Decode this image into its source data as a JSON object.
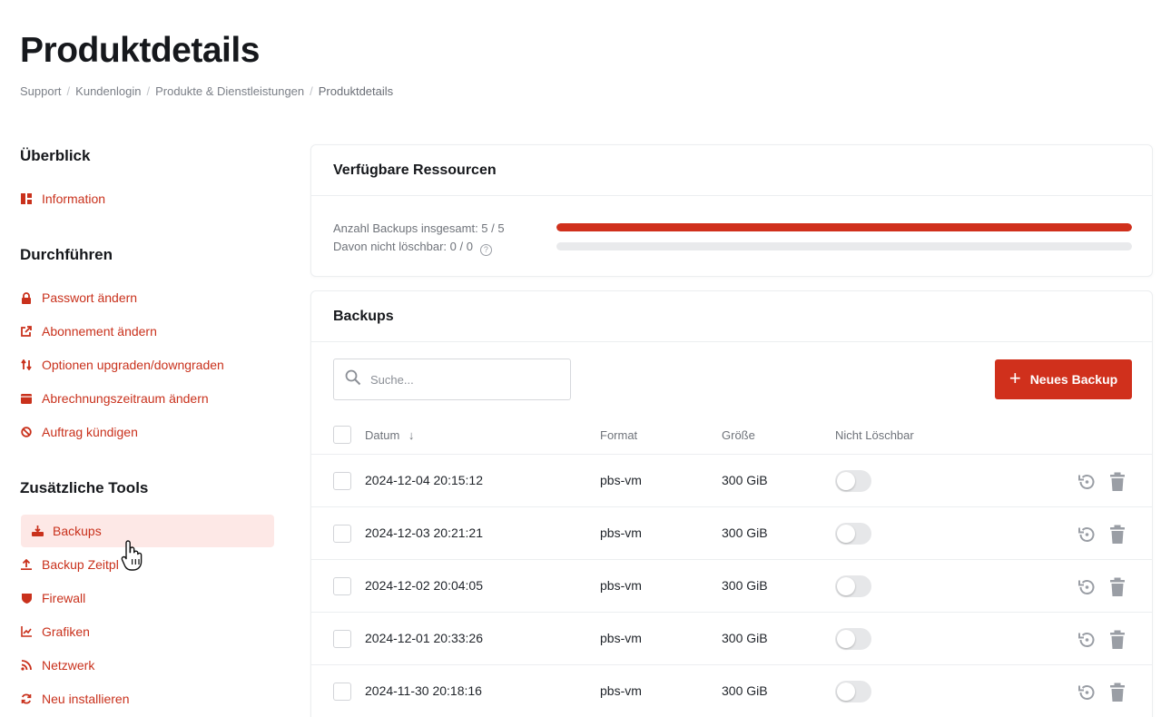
{
  "page": {
    "title": "Produktdetails",
    "breadcrumb": [
      "Support",
      "Kundenlogin",
      "Produkte & Dienstleistungen",
      "Produktdetails"
    ]
  },
  "sidebar": {
    "sections": [
      {
        "heading": "Überblick",
        "items": [
          {
            "label": "Information",
            "icon": "dashboard-icon"
          }
        ]
      },
      {
        "heading": "Durchführen",
        "items": [
          {
            "label": "Passwort ändern",
            "icon": "lock-icon"
          },
          {
            "label": "Abonnement ändern",
            "icon": "external-link-icon"
          },
          {
            "label": "Optionen upgraden/downgraden",
            "icon": "arrows-updown-icon"
          },
          {
            "label": "Abrechnungszeitraum ändern",
            "icon": "wallet-icon"
          },
          {
            "label": "Auftrag kündigen",
            "icon": "ban-icon"
          }
        ]
      },
      {
        "heading": "Zusätzliche Tools",
        "items": [
          {
            "label": "Backups",
            "icon": "download-tray-icon",
            "active": true
          },
          {
            "label": "Backup Zeitpl",
            "icon": "upload-icon"
          },
          {
            "label": "Firewall",
            "icon": "shield-icon"
          },
          {
            "label": "Grafiken",
            "icon": "chart-line-icon"
          },
          {
            "label": "Netzwerk",
            "icon": "rss-icon"
          },
          {
            "label": "Neu installieren",
            "icon": "refresh-icon"
          }
        ]
      }
    ]
  },
  "resources": {
    "title": "Verfügbare Ressourcen",
    "backups_total_label": "Anzahl Backups insgesamt: 5 / 5",
    "backups_total_fraction": 1.0,
    "not_deletable_label": "Davon nicht löschbar: 0 / 0",
    "not_deletable_fraction": 0.0,
    "help_glyph": "?"
  },
  "backups": {
    "title": "Backups",
    "search_placeholder": "Suche...",
    "new_button": "Neues Backup",
    "new_button_glyph": "+",
    "columns": {
      "date": "Datum",
      "format": "Format",
      "size": "Größe",
      "not_deletable": "Nicht Löschbar"
    },
    "sort_glyph": "↓",
    "rows": [
      {
        "date": "2024-12-04 20:15:12",
        "format": "pbs-vm",
        "size": "300 GiB",
        "not_deletable": false
      },
      {
        "date": "2024-12-03 20:21:21",
        "format": "pbs-vm",
        "size": "300 GiB",
        "not_deletable": false
      },
      {
        "date": "2024-12-02 20:04:05",
        "format": "pbs-vm",
        "size": "300 GiB",
        "not_deletable": false
      },
      {
        "date": "2024-12-01 20:33:26",
        "format": "pbs-vm",
        "size": "300 GiB",
        "not_deletable": false
      },
      {
        "date": "2024-11-30 20:18:16",
        "format": "pbs-vm",
        "size": "300 GiB",
        "not_deletable": false
      }
    ]
  },
  "colors": {
    "accent": "#d0301c",
    "active_bg": "#fde8e6",
    "toggle_off": "#e6e7e9"
  }
}
